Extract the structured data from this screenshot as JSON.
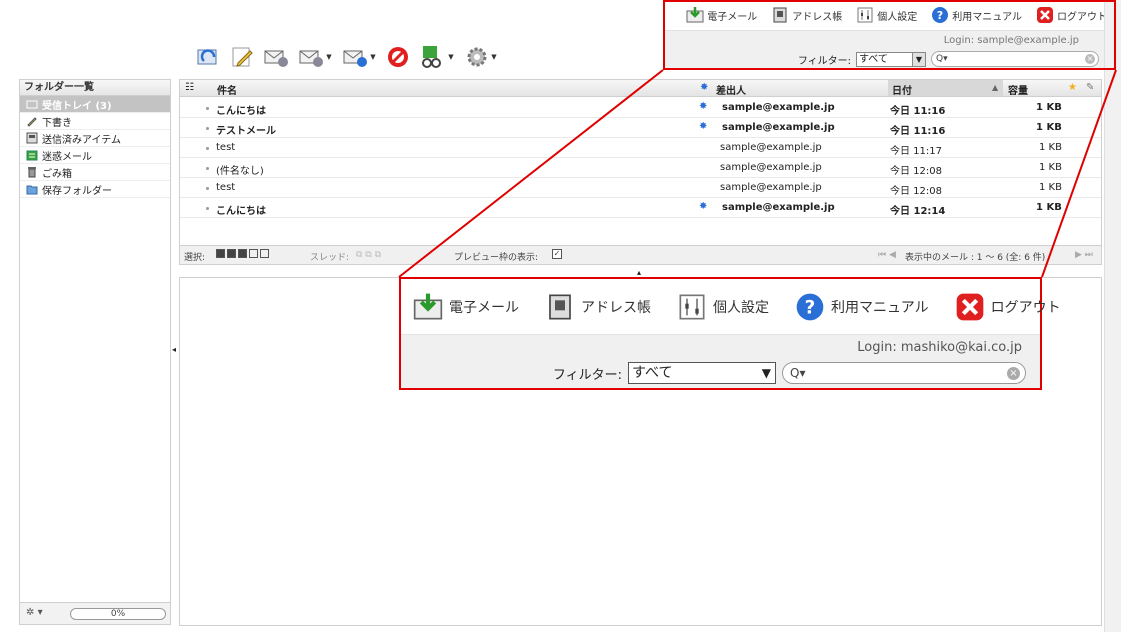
{
  "taskbar": {
    "mail": "電子メール",
    "addressbook": "アドレス帳",
    "settings": "個人設定",
    "manual": "利用マニュアル",
    "logout": "ログアウト"
  },
  "user": {
    "login": "Login: sample@example.jp",
    "filter_label": "フィルター:",
    "filter_value": "すべて"
  },
  "zoom": {
    "login": "Login: mashiko@kai.co.jp",
    "filter_label": "フィルター:",
    "filter_value": "すべて"
  },
  "folders": {
    "header": "フォルダー一覧",
    "items": [
      {
        "label": "受信トレイ (3)"
      },
      {
        "label": "下書き"
      },
      {
        "label": "送信済みアイテム"
      },
      {
        "label": "迷惑メール"
      },
      {
        "label": "ごみ箱"
      },
      {
        "label": "保存フォルダー"
      }
    ],
    "quota": "0%"
  },
  "list": {
    "columns": {
      "subject": "件名",
      "from": "差出人",
      "date": "日付",
      "size": "容量"
    },
    "rows": [
      {
        "subject": "こんにちは",
        "from": "sample@example.jp",
        "date": "今日 11:16",
        "size": "1 KB"
      },
      {
        "subject": "テストメール",
        "from": "sample@example.jp",
        "date": "今日 11:16",
        "size": "1 KB"
      },
      {
        "subject": "test",
        "from": "sample@example.jp",
        "date": "今日 11:17",
        "size": "1 KB"
      },
      {
        "subject": "(件名なし)",
        "from": "sample@example.jp",
        "date": "今日 12:08",
        "size": "1 KB"
      },
      {
        "subject": "test",
        "from": "sample@example.jp",
        "date": "今日 12:08",
        "size": "1 KB"
      },
      {
        "subject": "こんにちは",
        "from": "sample@example.jp",
        "date": "今日 12:14",
        "size": "1 KB"
      }
    ],
    "footer": {
      "select_label": "選択:",
      "thread_label": "スレッド:",
      "preview_label": "プレビュー枠の表示:",
      "count_text": "表示中のメール : 1 ～ 6 (全: 6 件)"
    }
  },
  "colors": {
    "accent": "#e00000",
    "selected_folder": "#c3c3c3",
    "unread_marker": "#2a6fd6"
  }
}
